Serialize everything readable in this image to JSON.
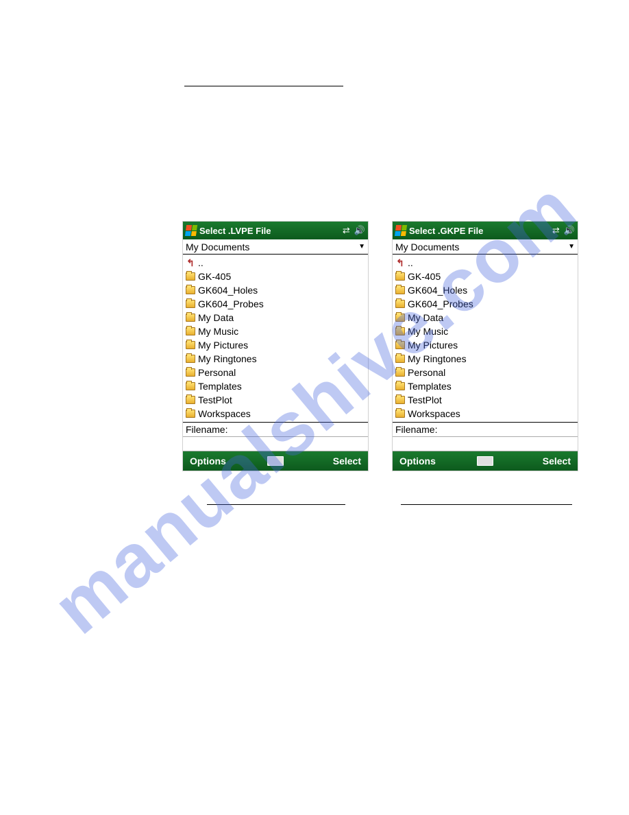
{
  "watermark": "manualshive.com",
  "screens": {
    "left": {
      "title": "Select .LVPE File",
      "dropdown": "My Documents",
      "up": "..",
      "folders": [
        "GK-405",
        "GK604_Holes",
        "GK604_Probes",
        "My Data",
        "My Music",
        "My Pictures",
        "My Ringtones",
        "Personal",
        "Templates",
        "TestPlot",
        "Workspaces"
      ],
      "filename_label": "Filename:",
      "options": "Options",
      "select": "Select"
    },
    "right": {
      "title": "Select .GKPE File",
      "dropdown": "My Documents",
      "up": "..",
      "folders": [
        "GK-405",
        "GK604_Holes",
        "GK604_Probes",
        "My Data",
        "My Music",
        "My Pictures",
        "My Ringtones",
        "Personal",
        "Templates",
        "TestPlot",
        "Workspaces"
      ],
      "filename_label": "Filename:",
      "options": "Options",
      "select": "Select"
    }
  }
}
